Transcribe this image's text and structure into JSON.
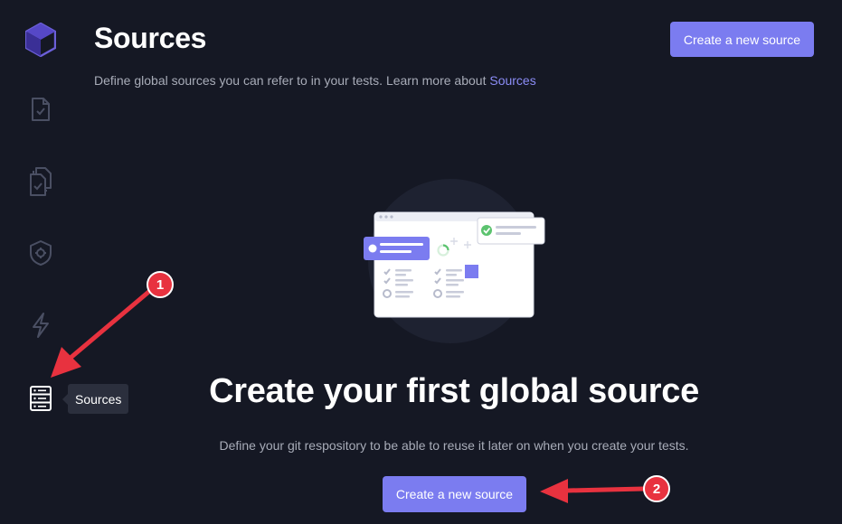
{
  "header": {
    "title": "Sources",
    "subtitle_text": "Define global sources you can refer to in your tests. Learn more about",
    "subtitle_link": "Sources",
    "create_button": "Create a new source"
  },
  "sidebar": {
    "items": [
      {
        "name": "logo",
        "icon": "logo-icon"
      },
      {
        "name": "tests",
        "icon": "file-check-icon"
      },
      {
        "name": "test-suites",
        "icon": "files-check-icon"
      },
      {
        "name": "executors",
        "icon": "shield-gear-icon"
      },
      {
        "name": "triggers",
        "icon": "lightning-icon"
      },
      {
        "name": "sources",
        "icon": "server-list-icon",
        "active": true
      }
    ],
    "tooltip": "Sources"
  },
  "empty_state": {
    "title": "Create your first global source",
    "description": "Define your git respository to be able to reuse it later on when you create your tests.",
    "button": "Create a new source"
  },
  "annotations": {
    "marker_1": "1",
    "marker_2": "2",
    "arrow_color": "#e8323f"
  },
  "colors": {
    "background": "#151824",
    "accent": "#7b7cf0",
    "link": "#8b8cf6",
    "muted_text": "#a8acb8",
    "sidebar_icon": "#4a4f63",
    "success": "#5cc36f"
  }
}
